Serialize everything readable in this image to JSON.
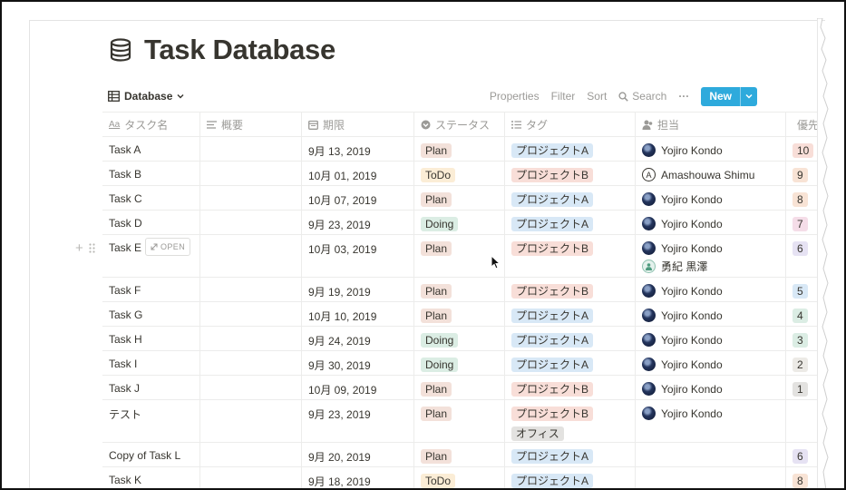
{
  "page": {
    "title": "Task Database"
  },
  "toolbar": {
    "view_label": "Database",
    "properties": "Properties",
    "filter": "Filter",
    "sort": "Sort",
    "search": "Search",
    "more": "···",
    "new_label": "New"
  },
  "columns": [
    {
      "label": "タスク名",
      "icon": "text-aa-icon"
    },
    {
      "label": "概要",
      "icon": "text-lines-icon"
    },
    {
      "label": "期限",
      "icon": "calendar-icon"
    },
    {
      "label": "ステータス",
      "icon": "select-icon"
    },
    {
      "label": "タグ",
      "icon": "multiselect-list-icon"
    },
    {
      "label": "担当",
      "icon": "person-icon"
    },
    {
      "label": "優先",
      "icon": "select-icon"
    }
  ],
  "row_actions": {
    "open_label": "OPEN"
  },
  "colors": {
    "Plan": "#f3e1da",
    "ToDo": "#fbedd6",
    "Doing": "#dbede4",
    "プロジェクトA": "#d8e8f6",
    "プロジェクトB": "#f8ded8",
    "オフィス": "#e3e2e0",
    "accent": "#2eaadc"
  },
  "rows": [
    {
      "name": "Task A",
      "summary": "",
      "due": "9月 13, 2019",
      "status": "Plan",
      "tags": [
        "プロジェクトA"
      ],
      "assignees": [
        {
          "name": "Yojiro Kondo",
          "avatar": "photo"
        }
      ],
      "priority": "10",
      "priority_color": "#f8ded8"
    },
    {
      "name": "Task B",
      "summary": "",
      "due": "10月 01, 2019",
      "status": "ToDo",
      "tags": [
        "プロジェクトB"
      ],
      "assignees": [
        {
          "name": "Amashouwa Shimu",
          "avatar": "letter",
          "initial": "A"
        }
      ],
      "priority": "9",
      "priority_color": "#f8e3d5"
    },
    {
      "name": "Task C",
      "summary": "",
      "due": "10月 07, 2019",
      "status": "Plan",
      "tags": [
        "プロジェクトA"
      ],
      "assignees": [
        {
          "name": "Yojiro Kondo",
          "avatar": "photo"
        }
      ],
      "priority": "8",
      "priority_color": "#f8e3d5"
    },
    {
      "name": "Task D",
      "summary": "",
      "due": "9月 23, 2019",
      "status": "Doing",
      "tags": [
        "プロジェクトA"
      ],
      "assignees": [
        {
          "name": "Yojiro Kondo",
          "avatar": "photo"
        }
      ],
      "priority": "7",
      "priority_color": "#f5dde8"
    },
    {
      "name": "Task E",
      "summary": "",
      "due": "10月 03, 2019",
      "status": "Plan",
      "tags": [
        "プロジェクトB"
      ],
      "assignees": [
        {
          "name": "Yojiro Kondo",
          "avatar": "photo"
        },
        {
          "name": "勇紀 黒澤",
          "avatar": "green"
        }
      ],
      "priority": "6",
      "priority_color": "#e6e2f3",
      "hovered": true
    },
    {
      "name": "Task F",
      "summary": "",
      "due": "9月 19, 2019",
      "status": "Plan",
      "tags": [
        "プロジェクトB"
      ],
      "assignees": [
        {
          "name": "Yojiro Kondo",
          "avatar": "photo"
        }
      ],
      "priority": "5",
      "priority_color": "#d8e8f6"
    },
    {
      "name": "Task G",
      "summary": "",
      "due": "10月 10, 2019",
      "status": "Plan",
      "tags": [
        "プロジェクトA"
      ],
      "assignees": [
        {
          "name": "Yojiro Kondo",
          "avatar": "photo"
        }
      ],
      "priority": "4",
      "priority_color": "#dbede4"
    },
    {
      "name": "Task H",
      "summary": "",
      "due": "9月 24, 2019",
      "status": "Doing",
      "tags": [
        "プロジェクトA"
      ],
      "assignees": [
        {
          "name": "Yojiro Kondo",
          "avatar": "photo"
        }
      ],
      "priority": "3",
      "priority_color": "#dbede4"
    },
    {
      "name": "Task I",
      "summary": "",
      "due": "9月 30, 2019",
      "status": "Doing",
      "tags": [
        "プロジェクトA"
      ],
      "assignees": [
        {
          "name": "Yojiro Kondo",
          "avatar": "photo"
        }
      ],
      "priority": "2",
      "priority_color": "#eceae6"
    },
    {
      "name": "Task J",
      "summary": "",
      "due": "10月 09, 2019",
      "status": "Plan",
      "tags": [
        "プロジェクトB"
      ],
      "assignees": [
        {
          "name": "Yojiro Kondo",
          "avatar": "photo"
        }
      ],
      "priority": "1",
      "priority_color": "#e3e2e0"
    },
    {
      "name": "テスト",
      "summary": "",
      "due": "9月 23, 2019",
      "status": "Plan",
      "tags": [
        "プロジェクトB",
        "オフィス"
      ],
      "assignees": [
        {
          "name": "Yojiro Kondo",
          "avatar": "photo"
        }
      ],
      "priority": "",
      "priority_color": ""
    },
    {
      "name": "Copy of Task L",
      "summary": "",
      "due": "9月 20, 2019",
      "status": "Plan",
      "tags": [
        "プロジェクトA"
      ],
      "assignees": [],
      "priority": "6",
      "priority_color": "#e6e2f3"
    },
    {
      "name": "Task K",
      "summary": "",
      "due": "9月 18, 2019",
      "status": "ToDo",
      "tags": [
        "プロジェクトA"
      ],
      "assignees": [],
      "priority": "8",
      "priority_color": "#f8e3d5"
    }
  ]
}
